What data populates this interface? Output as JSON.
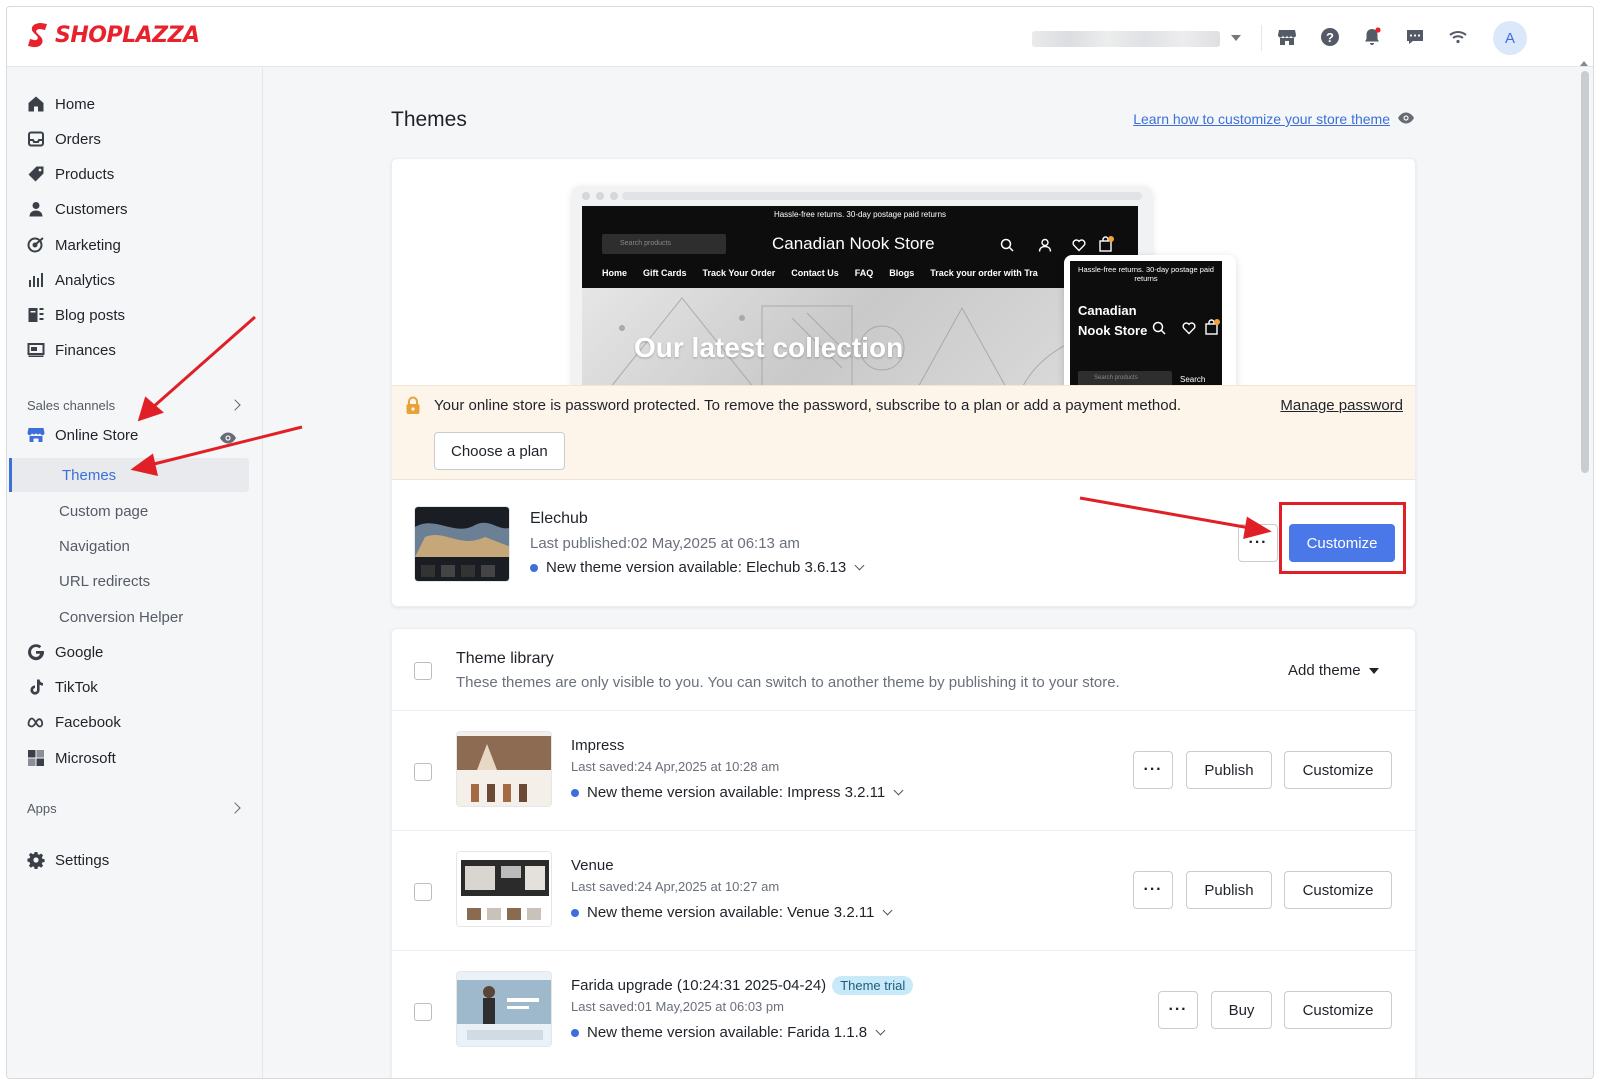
{
  "brand": {
    "name": "SHOPLAZZA",
    "color": "#e8222d"
  },
  "header": {
    "icons": [
      "store-icon",
      "help-icon",
      "bell-icon",
      "chat-icon",
      "wifi-icon"
    ],
    "avatar_initial": "A"
  },
  "sidebar": {
    "items": [
      {
        "label": "Home",
        "icon": "home-icon"
      },
      {
        "label": "Orders",
        "icon": "inbox-icon"
      },
      {
        "label": "Products",
        "icon": "tag-icon"
      },
      {
        "label": "Customers",
        "icon": "person-icon"
      },
      {
        "label": "Marketing",
        "icon": "target-icon"
      },
      {
        "label": "Analytics",
        "icon": "bar-chart-icon"
      },
      {
        "label": "Blog posts",
        "icon": "blog-icon"
      },
      {
        "label": "Finances",
        "icon": "finance-icon"
      }
    ],
    "sales_channels_label": "Sales channels",
    "online_store": "Online Store",
    "online_store_sub": [
      "Themes",
      "Custom page",
      "Navigation",
      "URL redirects",
      "Conversion Helper"
    ],
    "channels": [
      "Google",
      "TikTok",
      "Facebook",
      "Microsoft"
    ],
    "apps_label": "Apps",
    "settings": "Settings"
  },
  "main": {
    "title": "Themes",
    "learn_link": "Learn how to customize your store theme",
    "preview": {
      "promo": "Hassle-free returns. 30-day postage paid returns",
      "search_placeholder": "Search products",
      "store_name": "Canadian Nook Store",
      "menu": [
        "Home",
        "Gift Cards",
        "Track Your Order",
        "Contact Us",
        "FAQ",
        "Blogs",
        "Track your order with Tra"
      ],
      "hero_text": "Our latest collection",
      "mobile_name": "Canadian Nook Store",
      "mobile_search": "Search products",
      "mobile_search_btn": "Search"
    },
    "password_banner": {
      "text": "Your online store is password protected. To remove the password, subscribe to a plan or add a payment method.",
      "manage": "Manage password",
      "button": "Choose a plan"
    },
    "current_theme": {
      "name": "Elechub",
      "published": "Last published:02 May,2025 at 06:13 am",
      "version": "New theme version available: Elechub 3.6.13",
      "more": "···",
      "customize": "Customize"
    },
    "library": {
      "title": "Theme library",
      "subtitle": "These themes are only visible to you. You can switch to another theme by publishing it to your store.",
      "add_theme": "Add theme",
      "themes": [
        {
          "name": "Impress",
          "saved": "Last saved:24 Apr,2025 at 10:28 am",
          "version": "New theme version available: Impress 3.2.11",
          "action": "Publish",
          "customize": "Customize",
          "more": "···"
        },
        {
          "name": "Venue",
          "saved": "Last saved:24 Apr,2025 at 10:27 am",
          "version": "New theme version available: Venue 3.2.11",
          "action": "Publish",
          "customize": "Customize",
          "more": "···"
        },
        {
          "name": "Farida upgrade (10:24:31 2025-04-24)",
          "badge": "Theme trial",
          "saved": "Last saved:01 May,2025 at 06:03 pm",
          "version": "New theme version available: Farida 1.1.8",
          "action": "Buy",
          "customize": "Customize",
          "more": "···"
        }
      ]
    }
  },
  "colors": {
    "accent": "#3d6fd9",
    "primary_button": "#4a78e8",
    "annotation": "#e01f26",
    "banner": "#fdf4ea"
  }
}
